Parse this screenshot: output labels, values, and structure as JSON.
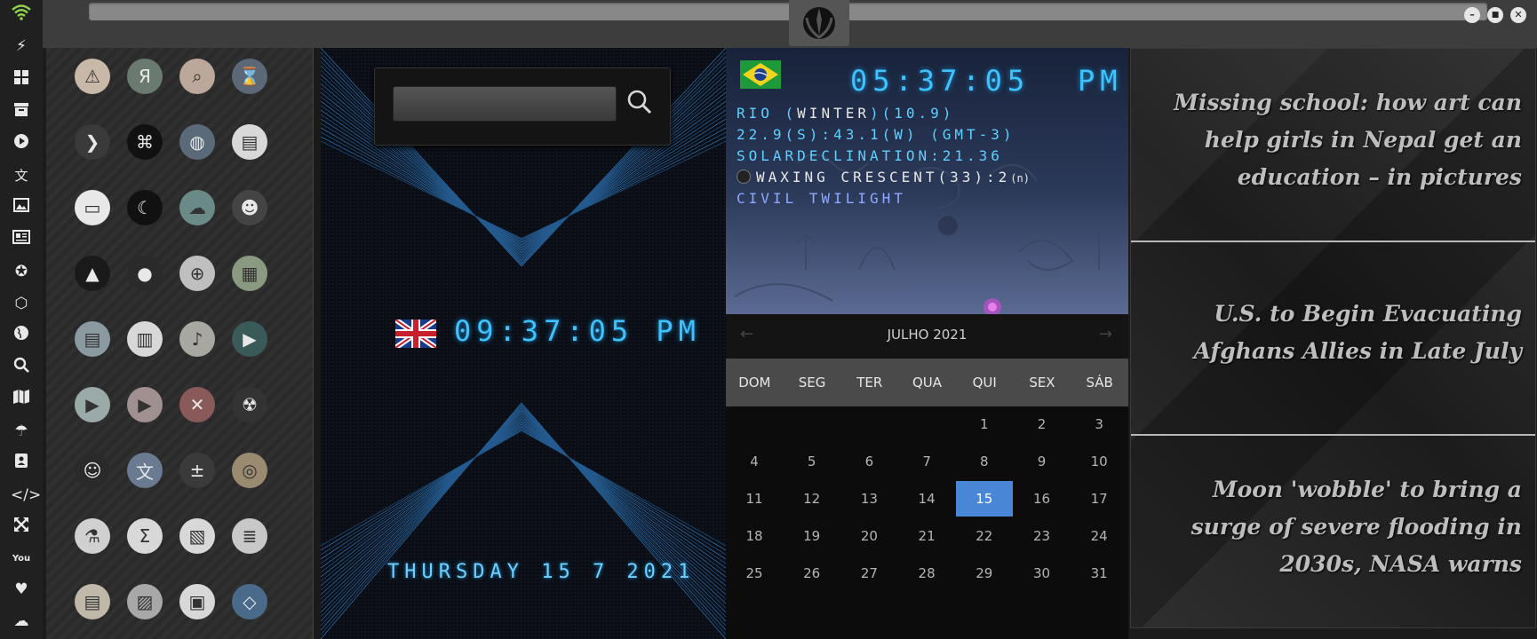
{
  "uk_clock": {
    "time": "09:37:05 PM",
    "date": "THURSDAY 15 7 2021"
  },
  "rio_clock": {
    "time": "05:37:05",
    "ampm": "PM",
    "location_prefix": "RIO (",
    "season": "WINTER",
    "location_suffix": ")(10.9)",
    "coords": "22.9(S):43.1(W) (GMT-3)",
    "solar": "SOLARDECLINATION:21.36",
    "moon_phase": "WAXING CRESCENT(33):2",
    "moon_suffix": "(n)",
    "twilight": "CIVIL TWILIGHT"
  },
  "calendar": {
    "month": "JULHO 2021",
    "prev": "←",
    "next": "→",
    "weekdays": [
      "DOM",
      "SEG",
      "TER",
      "QUA",
      "QUI",
      "SEX",
      "SÁB"
    ],
    "days": [
      "1",
      "2",
      "3",
      "4",
      "5",
      "6",
      "7",
      "8",
      "9",
      "10",
      "11",
      "12",
      "13",
      "14",
      "15",
      "16",
      "17",
      "18",
      "19",
      "20",
      "21",
      "22",
      "23",
      "24",
      "25",
      "26",
      "27",
      "28",
      "29",
      "30",
      "31"
    ],
    "first_weekday": 4,
    "today": "15",
    "today_color": "#4a86d6"
  },
  "news": {
    "items": [
      "Missing school: how art can help girls in Nepal get an education – in pictures",
      "U.S. to Begin Evacuating Afghans Allies in Late July",
      "Moon 'wobble' to bring a surge of severe flooding in 2030s, NASA warns"
    ]
  },
  "window_controls": {
    "minimize": "–",
    "maximize": "■",
    "close": "✕"
  },
  "dock_icons": [
    "wifi-icon",
    "flash-icon",
    "windows-icon",
    "archive-icon",
    "play-icon",
    "translate-icon",
    "image-icon",
    "news-icon",
    "rebel-icon",
    "empire-icon",
    "globe-icon",
    "search-icon",
    "map-icon",
    "umbrella-icon",
    "contacts-icon",
    "code-icon",
    "expand-icon",
    "youtube-icon",
    "heart-icon",
    "cloud-icon"
  ],
  "app_icons": [
    "alert-icon",
    "yandex-icon",
    "search-icon",
    "hourglass-icon",
    "arrow-icon",
    "terminal-icon",
    "globe-icon",
    "server-icon",
    "window-icon",
    "sleep-icon",
    "cloud-lock-icon",
    "github-icon",
    "starfleet-icon",
    "death-star-icon",
    "wikipedia-icon",
    "world-map-icon",
    "documents-icon",
    "notes-icon",
    "music-icon",
    "video-icon",
    "play-icon",
    "youtube-icon",
    "close-icon",
    "robot-icon",
    "c3po-icon",
    "translate-icon",
    "calculator-icon",
    "camera-icon",
    "flask-icon",
    "sigma-icon",
    "hex-icon",
    "text-editor-icon",
    "document-icon",
    "image-icon",
    "presentation-icon",
    "vscode-icon"
  ],
  "accent_color": "#3fc3ff"
}
